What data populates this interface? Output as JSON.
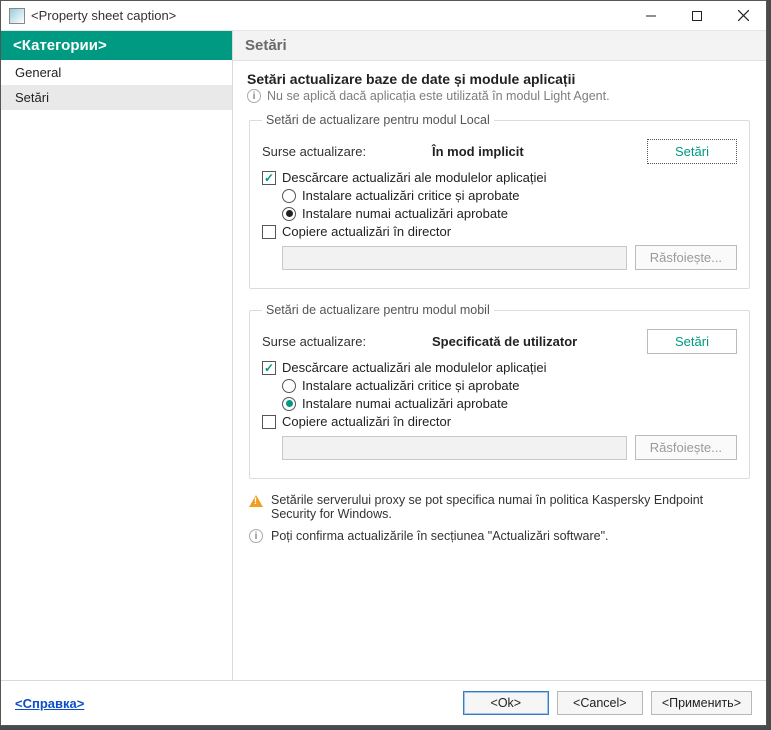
{
  "window": {
    "title": "<Property sheet caption>"
  },
  "sidebar": {
    "header": "<Категории>",
    "items": [
      {
        "label": "General"
      },
      {
        "label": "Setări"
      }
    ]
  },
  "main": {
    "header": "Setări",
    "section_title": "Setări actualizare baze de date și module aplicații",
    "info_note": "Nu se aplică dacă aplicația este utilizată în modul Light Agent.",
    "group_local": {
      "legend": "Setări de actualizare pentru modul Local",
      "source_label": "Surse actualizare:",
      "source_value": "În mod implicit",
      "settings_btn": "Setări",
      "download_modules": "Descărcare actualizări ale modulelor aplicației",
      "install_critical": "Instalare actualizări critice și aprobate",
      "install_approved": "Instalare numai actualizări aprobate",
      "copy_dir": "Copiere actualizări în director",
      "browse": "Răsfoiește..."
    },
    "group_mobile": {
      "legend": "Setări de actualizare pentru modul mobil",
      "source_label": "Surse actualizare:",
      "source_value": "Specificată de utilizator",
      "settings_btn": "Setări",
      "download_modules": "Descărcare actualizări ale modulelor aplicației",
      "install_critical": "Instalare actualizări critice și aprobate",
      "install_approved": "Instalare numai actualizări aprobate",
      "copy_dir": "Copiere actualizări în director",
      "browse": "Răsfoiește..."
    },
    "warn_note": "Setările serverului proxy se pot specifica numai în politica Kaspersky Endpoint Security for Windows.",
    "info_note2": "Poți confirma actualizările în secțiunea \"Actualizări software\"."
  },
  "footer": {
    "help": "<Справка>",
    "ok": "<Ok>",
    "cancel": "<Cancel>",
    "apply": "<Применить>"
  }
}
